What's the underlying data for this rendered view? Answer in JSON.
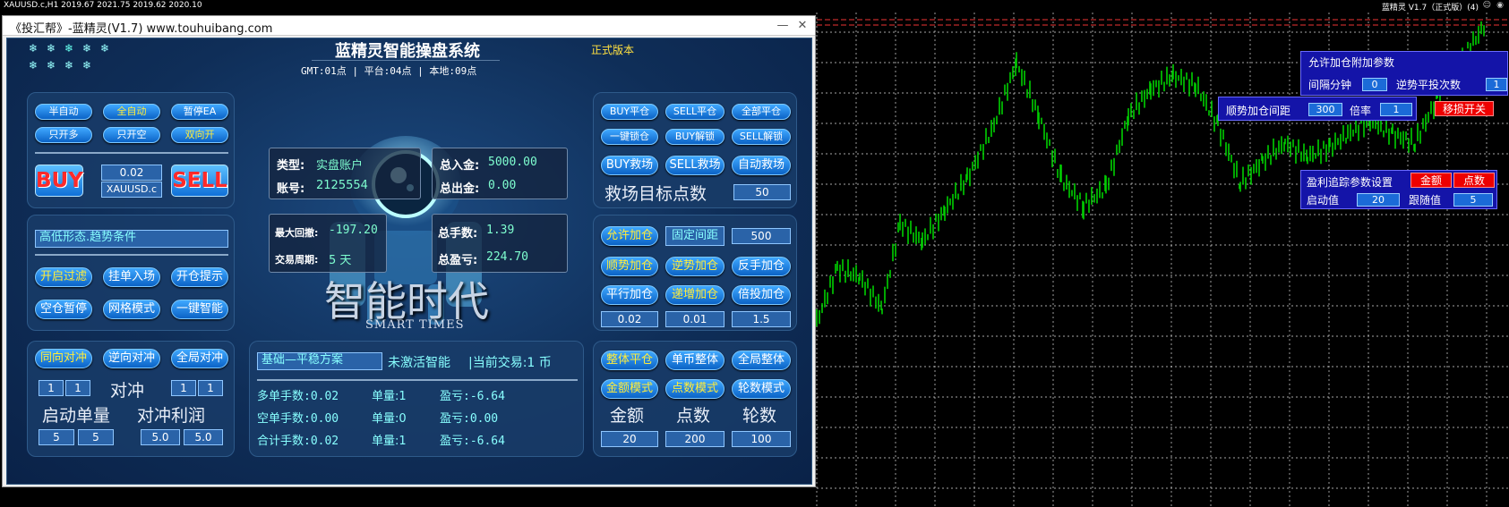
{
  "topbar": {
    "left": "XAUUSD.c,H1  2019.67 2021.75 2019.62 2020.10",
    "right": "蓝精灵 V1.7（正式版）(4)"
  },
  "window": {
    "title": "《投汇帮》-蓝精灵(V1.7) www.touhuibang.com",
    "min": "—",
    "close": "✕"
  },
  "header": {
    "title": "蓝精灵智能操盘系统",
    "version": "正式版本",
    "time": "GMT:01点 | 平台:04点 | 本地:09点"
  },
  "left1": {
    "semi": "半自动",
    "full": "全自动",
    "pause": "暂停EA",
    "only_long": "只开多",
    "only_short": "只开空",
    "both": "双向开",
    "buy": "BUY",
    "sell": "SELL",
    "lot": "0.02",
    "symbol": "XAUUSD.c"
  },
  "left2": {
    "condition": "高低形态.趋势条件",
    "filter": "开启过滤",
    "pending": "挂单入场",
    "tip": "开仓提示",
    "empty_pause": "空仓暂停",
    "grid": "网格模式",
    "smart": "一键智能"
  },
  "left3": {
    "same": "同向对冲",
    "reverse": "逆向对冲",
    "global": "全局对冲",
    "f1": "1",
    "f2": "1",
    "f3": "1",
    "f4": "1",
    "hedge": "对冲",
    "start_lot": "启动单量",
    "hedge_profit": "对冲利润",
    "f5": "5",
    "f6": "5",
    "f7": "5.0",
    "f8": "5.0"
  },
  "account": {
    "type_k": "类型:",
    "type_v": "实盘账户",
    "acct_k": "账号:",
    "acct_v": "2125554",
    "in_k": "总入金:",
    "in_v": "5000.00",
    "out_k": "总出金:",
    "out_v": "0.00",
    "dd_k": "最大回撤:",
    "dd_v": "-197.20",
    "period_k": "交易周期:",
    "period_v": "5 天",
    "lots_k": "总手数:",
    "lots_v": "1.39",
    "pl_k": "总盈亏:",
    "pl_v": "224.70"
  },
  "brand": {
    "cn": "智能时代",
    "en": "SMART TIMES"
  },
  "center_bottom": {
    "plan": "基础—平稳方案",
    "status": "未激活智能",
    "current": "|当前交易:1 币",
    "rows": [
      {
        "a": "多单手数:0.02",
        "b": "单量:1",
        "c": "盈亏:-6.64"
      },
      {
        "a": "空单手数:0.00",
        "b": "单量:0",
        "c": "盈亏:0.00"
      },
      {
        "a": "合计手数:0.02",
        "b": "单量:1",
        "c": "盈亏:-6.64"
      }
    ]
  },
  "right1": {
    "buy_close": "BUY平仓",
    "sell_close": "SELL平仓",
    "all_close": "全部平仓",
    "lock": "一键锁仓",
    "buy_unlock": "BUY解锁",
    "sell_unlock": "SELL解锁",
    "buy_rescue": "BUY救场",
    "sell_rescue": "SELL救场",
    "auto_rescue": "自动救场",
    "target": "救场目标点数",
    "target_v": "50"
  },
  "right2": {
    "allow_add": "允许加仓",
    "fixed_gap": "固定间距",
    "gap_v": "500",
    "trend_add": "顺势加仓",
    "counter_add": "逆势加仓",
    "rev_add": "反手加仓",
    "flat_add": "平行加仓",
    "inc_add": "递增加仓",
    "mult_add": "倍投加仓",
    "v1": "0.02",
    "v2": "0.01",
    "v3": "1.5"
  },
  "right3": {
    "whole_close": "整体平仓",
    "single_whole": "单币整体",
    "global_whole": "全局整体",
    "amount_mode": "金额模式",
    "points_mode": "点数模式",
    "rounds_mode": "轮数模式",
    "amount": "金额",
    "points": "点数",
    "rounds": "轮数",
    "v1": "20",
    "v2": "200",
    "v3": "100"
  },
  "overlay": {
    "title": "允许加仓附加参数",
    "interval": "间隔分钟",
    "interval_v": "0",
    "counter_times": "逆势平投次数",
    "counter_v": "1",
    "trend_gap": "顺势加仓间距",
    "trend_gap_v": "300",
    "ratio": "倍率",
    "ratio_v": "1",
    "move_switch": "移损开关",
    "trail_title": "盈利追踪参数设置",
    "amount": "金额",
    "points": "点数",
    "start": "启动值",
    "start_v": "20",
    "follow": "跟随值",
    "follow_v": "5"
  }
}
